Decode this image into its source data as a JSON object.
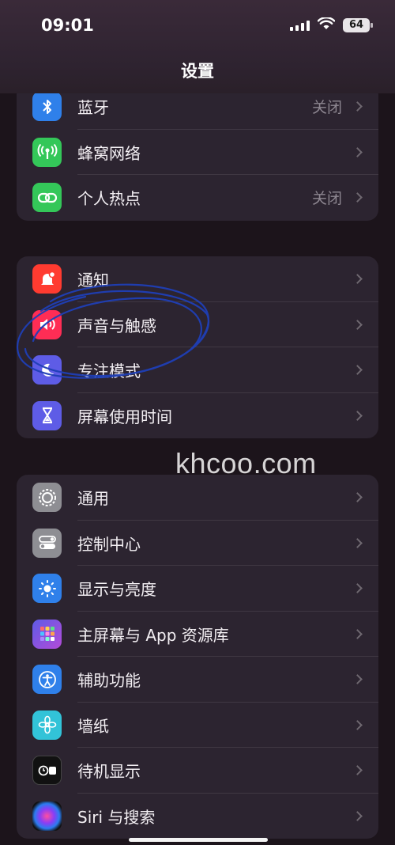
{
  "status_bar": {
    "time": "09:01",
    "battery": "64"
  },
  "header": {
    "title": "设置"
  },
  "groups": [
    {
      "rows": [
        {
          "label": "蓝牙",
          "value": "关闭",
          "icon": "bluetooth-icon",
          "color": "#2f80ea"
        },
        {
          "label": "蜂窝网络",
          "value": "",
          "icon": "cellular-icon",
          "color": "#34c759"
        },
        {
          "label": "个人热点",
          "value": "关闭",
          "icon": "hotspot-icon",
          "color": "#34c759"
        }
      ]
    },
    {
      "rows": [
        {
          "label": "通知",
          "icon": "notification-bell-icon",
          "color": "#ff3b30"
        },
        {
          "label": "声音与触感",
          "icon": "speaker-icon",
          "color": "#ff2d55"
        },
        {
          "label": "专注模式",
          "icon": "moon-icon",
          "color": "#5e5ce6"
        },
        {
          "label": "屏幕使用时间",
          "icon": "hourglass-icon",
          "color": "#5e5ce6"
        }
      ]
    },
    {
      "rows": [
        {
          "label": "通用",
          "icon": "gear-icon",
          "color": "#8e8e93"
        },
        {
          "label": "控制中心",
          "icon": "toggles-icon",
          "color": "#8e8e93"
        },
        {
          "label": "显示与亮度",
          "icon": "sun-icon",
          "color": "#2f80ea"
        },
        {
          "label": "主屏幕与 App 资源库",
          "icon": "app-grid-icon",
          "color": "#5e5ce6"
        },
        {
          "label": "辅助功能",
          "icon": "accessibility-icon",
          "color": "#2f80ea"
        },
        {
          "label": "墙纸",
          "icon": "flower-icon",
          "color": "#32c3d8"
        },
        {
          "label": "待机显示",
          "icon": "standby-icon",
          "color": "#111111"
        },
        {
          "label": "Siri 与搜索",
          "icon": "siri-icon",
          "color": "#222222"
        }
      ]
    }
  ],
  "watermark": "khcoo.com"
}
